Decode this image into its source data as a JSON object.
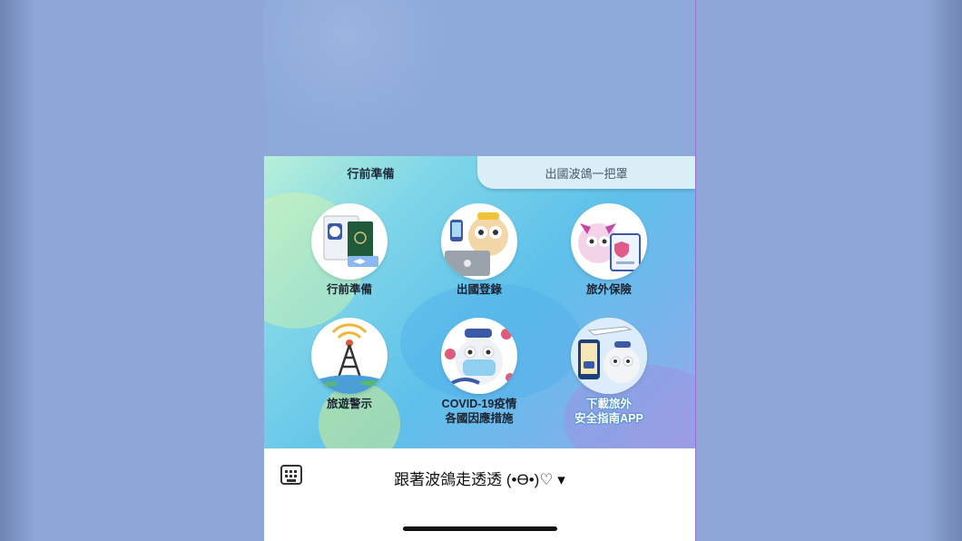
{
  "tabs": [
    {
      "label": "行前準備",
      "active": true
    },
    {
      "label": "出國波鴿一把罩",
      "active": false
    }
  ],
  "menu_items": [
    {
      "label": "行前準備",
      "icon": "passport-icon"
    },
    {
      "label": "出國登錄",
      "icon": "laptop-owl-icon"
    },
    {
      "label": "旅外保險",
      "icon": "insurance-owl-icon"
    },
    {
      "label": "旅遊警示",
      "icon": "signal-tower-icon"
    },
    {
      "label_line1": "COVID-19疫情",
      "label_line2": "各國因應措施",
      "icon": "mask-owl-icon"
    },
    {
      "label_line1": "下載旅外",
      "label_line2": "安全指南APP",
      "icon": "app-download-icon"
    }
  ],
  "bottom_bar": {
    "menu_title": "跟著波鴿走透透 (•ϴ•)♡ ▾",
    "keyboard_icon": "keyboard-icon"
  },
  "colors": {
    "menu_gradient_start": "#b8f0d8",
    "menu_gradient_end": "#9aa8e6",
    "chat_background": "#8ca9d9",
    "label_highlight": "#2f86c8"
  }
}
